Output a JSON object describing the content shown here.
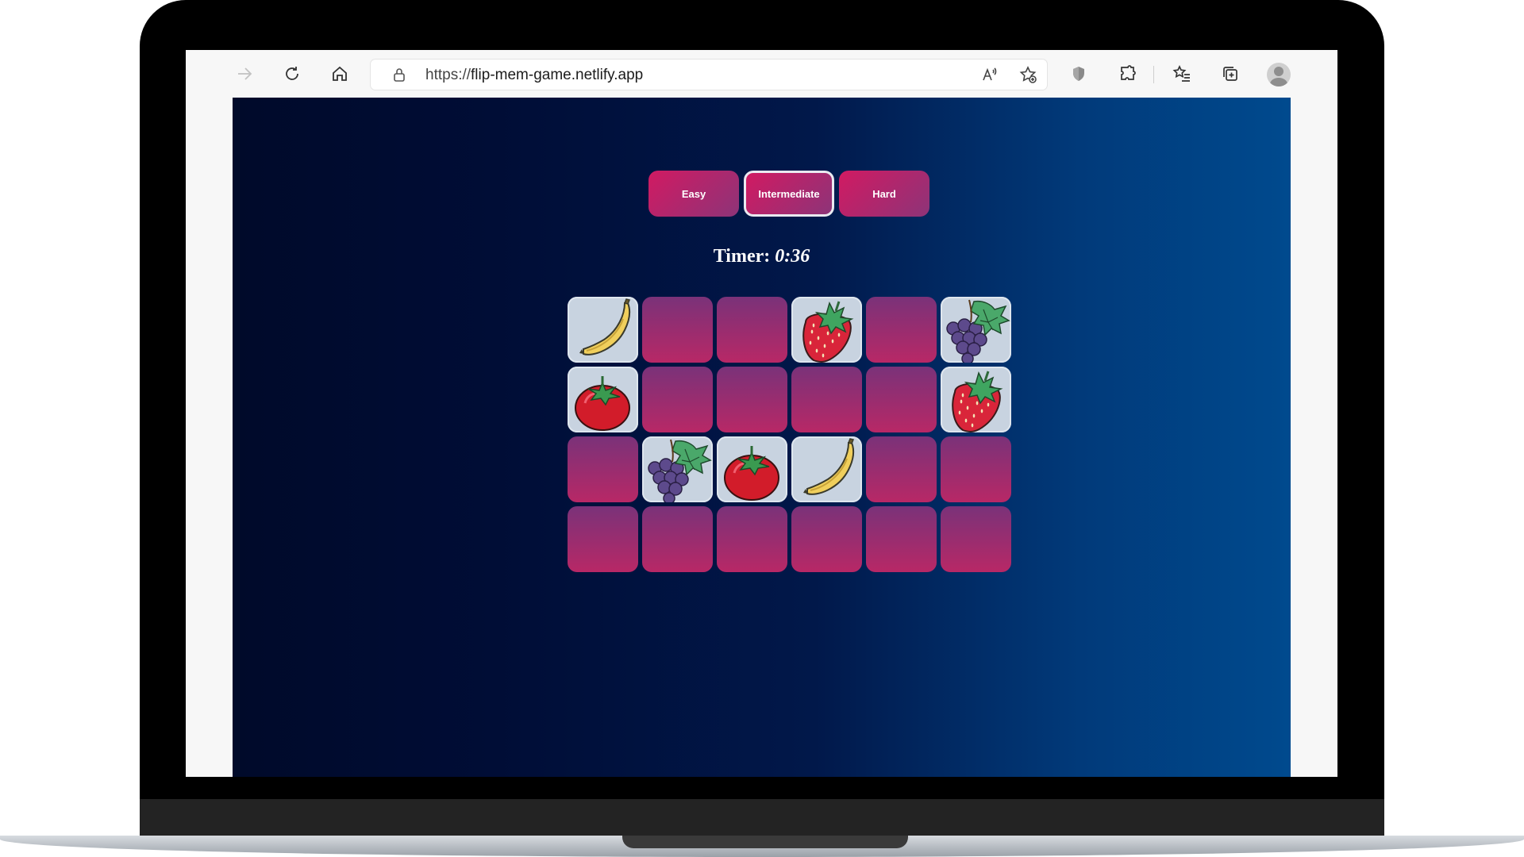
{
  "browser": {
    "url_scheme": "https://",
    "url_host": "flip-mem-game.netlify.app",
    "toolbar_icons": [
      "back-arrow-icon",
      "refresh-icon",
      "home-icon",
      "lock-icon",
      "read-aloud-icon",
      "add-favorite-icon",
      "shield-icon",
      "extensions-icon",
      "favorites-icon",
      "collections-icon",
      "profile-avatar-icon"
    ]
  },
  "game": {
    "levels": [
      {
        "label": "Easy",
        "selected": false
      },
      {
        "label": "Intermediate",
        "selected": true
      },
      {
        "label": "Hard",
        "selected": false
      }
    ],
    "timer_label": "Timer:",
    "timer_value": "0:36",
    "grid_columns": 6,
    "cards": [
      "banana",
      null,
      null,
      "strawberry",
      null,
      "grapes",
      "tomato",
      null,
      null,
      null,
      null,
      "strawberry",
      null,
      "grapes",
      "tomato",
      "banana",
      null,
      null,
      null,
      null,
      null,
      null,
      null,
      null
    ]
  },
  "colors": {
    "card_back_top": "#7a3279",
    "card_back_bottom": "#b82866",
    "card_face": "#c8d3e0",
    "button_start": "#d11a62",
    "button_end": "#8d3478",
    "page_left": "#000a2a",
    "page_right": "#004a8e"
  }
}
